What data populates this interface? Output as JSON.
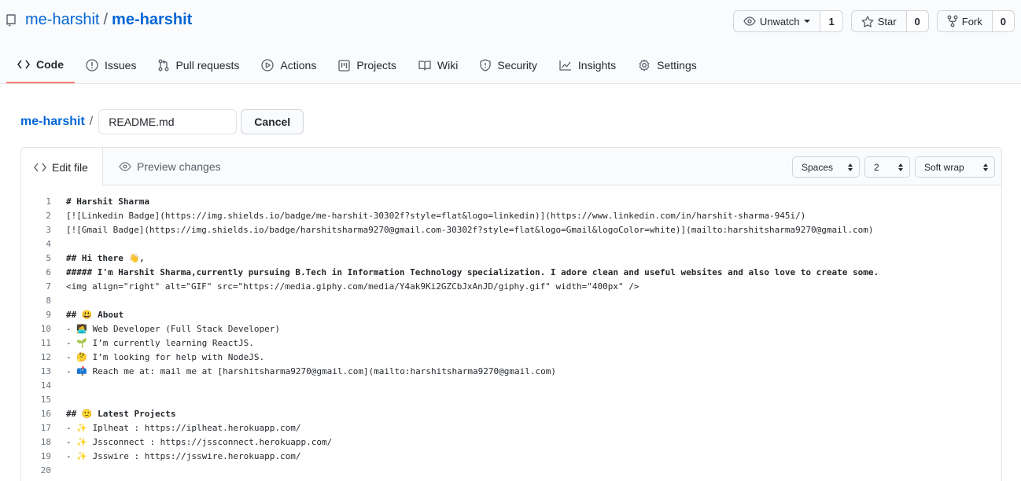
{
  "repo": {
    "owner": "me-harshit",
    "separator": "/",
    "name": "me-harshit"
  },
  "actions": {
    "watch": {
      "label": "Unwatch",
      "count": "1"
    },
    "star": {
      "label": "Star",
      "count": "0"
    },
    "fork": {
      "label": "Fork",
      "count": "0"
    }
  },
  "tabs": [
    {
      "label": "Code",
      "icon": "code-icon"
    },
    {
      "label": "Issues",
      "icon": "issue-icon"
    },
    {
      "label": "Pull requests",
      "icon": "pull-request-icon"
    },
    {
      "label": "Actions",
      "icon": "play-icon"
    },
    {
      "label": "Projects",
      "icon": "project-icon"
    },
    {
      "label": "Wiki",
      "icon": "book-icon"
    },
    {
      "label": "Security",
      "icon": "shield-icon"
    },
    {
      "label": "Insights",
      "icon": "graph-icon"
    },
    {
      "label": "Settings",
      "icon": "gear-icon"
    }
  ],
  "breadcrumb": {
    "owner": "me-harshit",
    "separator": "/",
    "filename": "README.md",
    "cancel": "Cancel"
  },
  "editor": {
    "edit_tab": "Edit file",
    "preview_tab": "Preview changes",
    "indent_mode": "Spaces",
    "indent_size": "2",
    "wrap_mode": "Soft wrap"
  },
  "code_lines": [
    {
      "n": "1",
      "text": "# Harshit Sharma"
    },
    {
      "n": "2",
      "text": "[![Linkedin Badge](https://img.shields.io/badge/me-harshit-30302f?style=flat&logo=linkedin)](https://www.linkedin.com/in/harshit-sharma-945i/)"
    },
    {
      "n": "3",
      "text": "[![Gmail Badge](https://img.shields.io/badge/harshitsharma9270@gmail.com-30302f?style=flat&logo=Gmail&logoColor=white)](mailto:harshitsharma9270@gmail.com)"
    },
    {
      "n": "4",
      "text": ""
    },
    {
      "n": "5",
      "text": "## Hi there 👋,"
    },
    {
      "n": "6",
      "text": "##### I'm Harshit Sharma,currently pursuing B.Tech in Information Technology specialization. I adore clean and useful websites and also love to create some."
    },
    {
      "n": "7",
      "text": "<img align=\"right\" alt=\"GIF\" src=\"https://media.giphy.com/media/Y4ak9Ki2GZCbJxAnJD/giphy.gif\" width=\"400px\" />"
    },
    {
      "n": "8",
      "text": ""
    },
    {
      "n": "9",
      "text": "## 😃 About"
    },
    {
      "n": "10",
      "text": "- 🧑‍💻 Web Developer (Full Stack Developer)"
    },
    {
      "n": "11",
      "text": "- 🌱 I’m currently learning ReactJS."
    },
    {
      "n": "12",
      "text": "- 🤔 I’m looking for help with NodeJS."
    },
    {
      "n": "13",
      "text": "- 📫 Reach me at: mail me at [harshitsharma9270@gmail.com](mailto:harshitsharma9270@gmail.com)"
    },
    {
      "n": "14",
      "text": ""
    },
    {
      "n": "15",
      "text": ""
    },
    {
      "n": "16",
      "text": "## 🙂 Latest Projects"
    },
    {
      "n": "17",
      "text": "- ✨ Iplheat : https://iplheat.herokuapp.com/"
    },
    {
      "n": "18",
      "text": "- ✨ Jssconnect : https://jssconnect.herokuapp.com/"
    },
    {
      "n": "19",
      "text": "- ✨ Jsswire : https://jsswire.herokuapp.com/"
    },
    {
      "n": "20",
      "text": ""
    }
  ]
}
